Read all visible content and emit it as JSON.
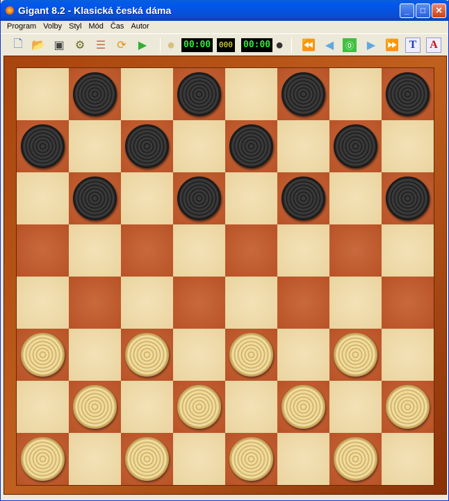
{
  "window": {
    "title": "Gigant 8.2 - Klasická česká dáma"
  },
  "menu": [
    "Program",
    "Volby",
    "Styl",
    "Mód",
    "Čas",
    "Autor"
  ],
  "toolbar": {
    "clock_white": "00:00",
    "move_counter": "000",
    "clock_black": "00:00",
    "buttons": [
      "new-game",
      "open",
      "save",
      "settings",
      "info",
      "rotate-board",
      "play",
      "first-move",
      "previous-move",
      "stop",
      "next-move",
      "last-move",
      "text-notation",
      "font"
    ]
  },
  "colors": {
    "light_square": "#ecd6a4",
    "dark_square": "#bf5c2e",
    "frame": "#b0501a",
    "clock_digits": "#2de83a",
    "counter_digits": "#ffff40"
  },
  "board": {
    "rows": [
      "-b-b-b-b",
      "b-b-b-b-",
      "-b-b-b-b",
      "--------",
      "--------",
      "w-w-w-w-",
      "-w-w-w-w",
      "w-w-w-w-"
    ]
  }
}
